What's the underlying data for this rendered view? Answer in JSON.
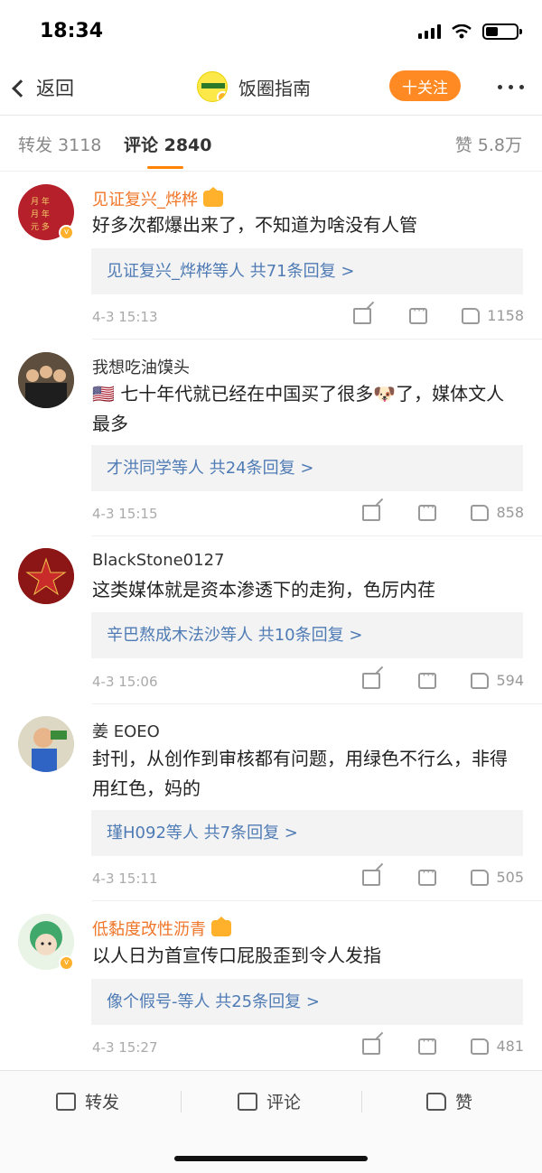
{
  "status": {
    "time": "18:34"
  },
  "nav": {
    "back_label": "返回",
    "title": "饭圈指南",
    "follow_label": "十关注"
  },
  "tabs": {
    "repost": "转发 3118",
    "comments": "评论 2840",
    "likes": "赞 5.8万"
  },
  "comments": [
    {
      "name": "见证复兴_烨桦",
      "text": "好多次都爆出来了，不知道为啥没有人管",
      "reply_summary": "见证复兴_烨桦等人  共71条回复 >",
      "time": "4-3 15:13",
      "likes": "1158"
    },
    {
      "name": "我想吃油馍头",
      "text": "🇺🇸 七十年代就已经在中国买了很多🐶了，媒体文人最多",
      "reply_summary": "才洪同学等人  共24条回复 >",
      "time": "4-3 15:15",
      "likes": "858"
    },
    {
      "name": "BlackStone0127",
      "text": "这类媒体就是资本渗透下的走狗，色厉内荏",
      "reply_summary": "辛巴熬成木法沙等人  共10条回复 >",
      "time": "4-3 15:06",
      "likes": "594"
    },
    {
      "name": "姜 EOEO",
      "text": "封刊，从创作到审核都有问题，用绿色不行么，非得用红色，妈的",
      "reply_summary": "瑾H092等人  共7条回复 >",
      "time": "4-3 15:11",
      "likes": "505"
    },
    {
      "name": "低黏度改性沥青",
      "text": "以人日为首宣传口屁股歪到令人发指",
      "reply_summary": "像个假号-等人  共25条回复 >",
      "time": "4-3 15:27",
      "likes": "481"
    }
  ],
  "bottom": {
    "repost": "转发",
    "comment": "评论",
    "like": "赞"
  },
  "colors": {
    "accent": "#ff8200",
    "link": "#4f7bb5",
    "vip_name": "#f0762a"
  }
}
